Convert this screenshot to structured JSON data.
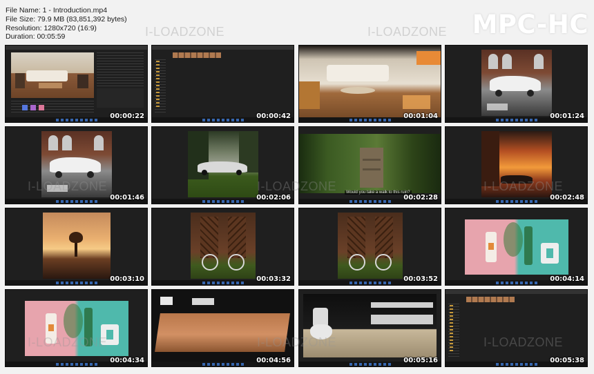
{
  "file_info": {
    "name": "File Name: 1 - Introduction.mp4",
    "size": "File Size: 79.9 MB (83,851,392 bytes)",
    "resolution": "Resolution: 1280x720 (16:9)",
    "duration": "Duration: 00:05:59"
  },
  "brand": "MPC-HC",
  "watermark": "I-LOADZONE",
  "thumbnails": [
    {
      "time": "00:00:22",
      "scene": "editor-interior"
    },
    {
      "time": "00:00:42",
      "scene": "editor-empty"
    },
    {
      "time": "00:01:04",
      "scene": "living-room"
    },
    {
      "time": "00:01:24",
      "scene": "car-hall"
    },
    {
      "time": "00:01:46",
      "scene": "car-hall"
    },
    {
      "time": "00:02:06",
      "scene": "car-forest"
    },
    {
      "time": "00:02:28",
      "scene": "stone-ruin"
    },
    {
      "time": "00:02:48",
      "scene": "sunset-car"
    },
    {
      "time": "00:03:10",
      "scene": "sunset-tree"
    },
    {
      "time": "00:03:32",
      "scene": "bicycle-door"
    },
    {
      "time": "00:03:52",
      "scene": "bicycle-door"
    },
    {
      "time": "00:04:14",
      "scene": "cosmetics"
    },
    {
      "time": "00:04:34",
      "scene": "cosmetics"
    },
    {
      "time": "00:04:56",
      "scene": "wood-table"
    },
    {
      "time": "00:05:16",
      "scene": "bathroom"
    },
    {
      "time": "00:05:38",
      "scene": "editor-empty"
    }
  ],
  "captions": {
    "stone_ruin": "Would you take a walk to this ruin?"
  }
}
